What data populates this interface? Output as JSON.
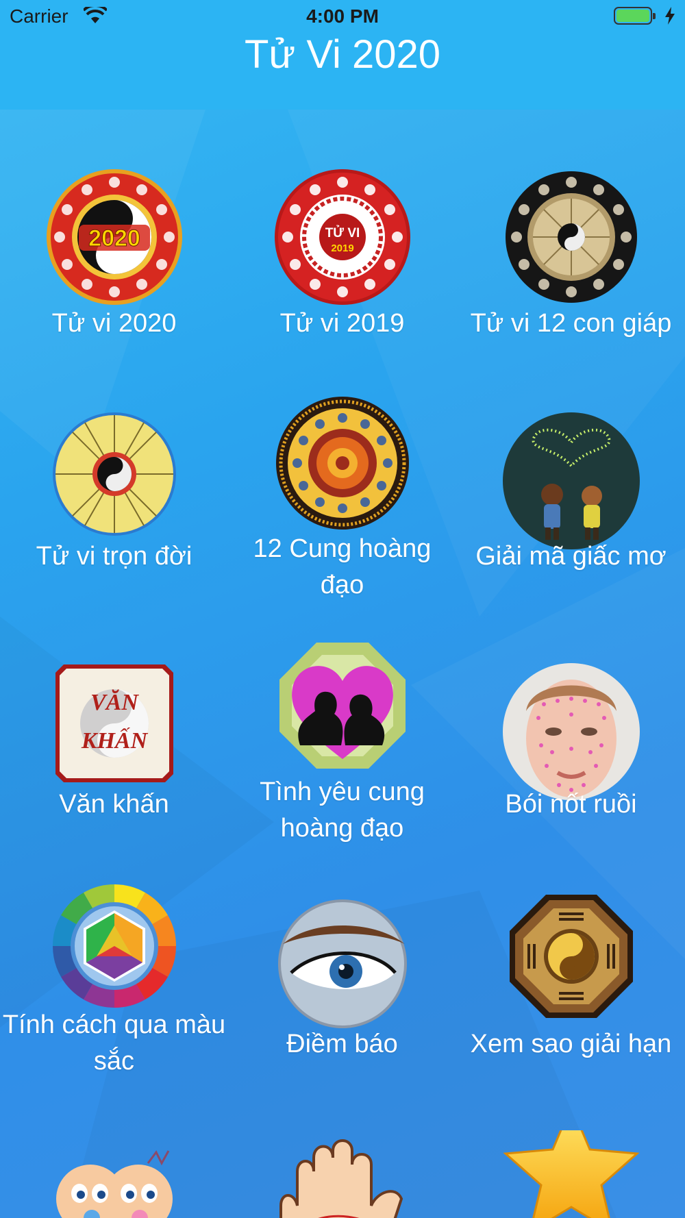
{
  "status": {
    "carrier": "Carrier",
    "time": "4:00 PM"
  },
  "nav": {
    "title": "Tử Vi 2020"
  },
  "items": [
    {
      "label": "Tử vi 2020",
      "badge_text": "2020",
      "icon": "zodiac-2020-wheel-icon"
    },
    {
      "label": "Tử vi 2019",
      "badge_text": "TỬ VI",
      "badge_sub": "2019",
      "icon": "zodiac-2019-wheel-icon"
    },
    {
      "label": "Tử vi 12 con giáp",
      "icon": "twelve-animals-wheel-icon"
    },
    {
      "label": "Tử vi trọn đời",
      "icon": "lifetime-horoscope-wheel-icon"
    },
    {
      "label": "12 Cung hoàng đạo",
      "icon": "zodiac-signs-wheel-icon"
    },
    {
      "label": "Giải mã giấc mơ",
      "icon": "dream-children-heart-icon"
    },
    {
      "label": "Văn khấn",
      "icon": "prayer-scroll-icon"
    },
    {
      "label": "Tình yêu cung hoàng đạo",
      "icon": "couple-heart-bagua-icon"
    },
    {
      "label": "Bói nốt ruồi",
      "icon": "face-moles-icon"
    },
    {
      "label": "Tính cách qua màu sắc",
      "icon": "color-wheel-icon"
    },
    {
      "label": "Điềm báo",
      "icon": "eye-omen-icon"
    },
    {
      "label": "Xem sao giải hạn",
      "icon": "bagua-yinyang-icon"
    },
    {
      "label": "",
      "icon": "babies-icon"
    },
    {
      "label": "",
      "icon": "palm-reading-icon"
    },
    {
      "label": "",
      "icon": "star-icon"
    }
  ]
}
